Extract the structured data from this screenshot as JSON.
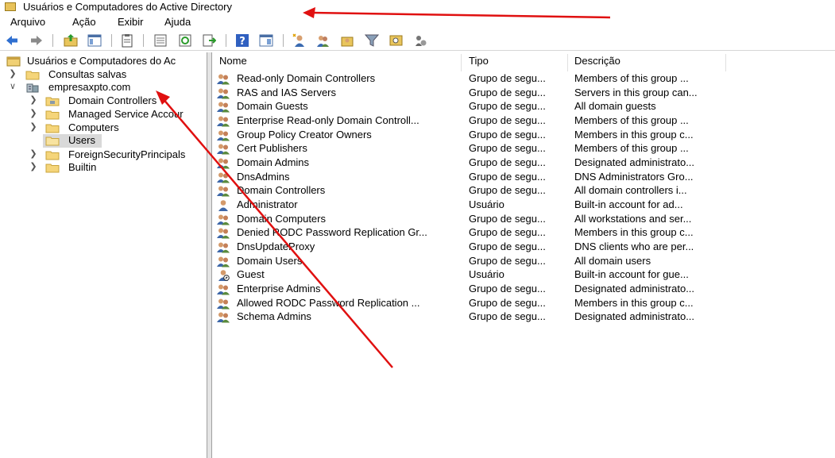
{
  "window": {
    "title": "Usuários e Computadores do Active Directory"
  },
  "menu": [
    "Arquivo",
    "Ação",
    "Exibir",
    "Ajuda"
  ],
  "tree": {
    "root": "Usuários e Computadores do Ac",
    "saved_queries": "Consultas salvas",
    "domain": "empresaxpto.com",
    "children": [
      "Domain Controllers",
      "Managed Service Accour",
      "Computers",
      "Users",
      "ForeignSecurityPrincipals",
      "Builtin"
    ],
    "selected": "Users"
  },
  "columns": {
    "name": "Nome",
    "type": "Tipo",
    "description": "Descrição"
  },
  "rows": [
    {
      "icon": "group",
      "name": "Read-only Domain Controllers",
      "type": "Grupo de segu...",
      "description": "Members of this group ..."
    },
    {
      "icon": "group",
      "name": "RAS and IAS Servers",
      "type": "Grupo de segu...",
      "description": "Servers in this group can..."
    },
    {
      "icon": "group",
      "name": "Domain Guests",
      "type": "Grupo de segu...",
      "description": "All domain guests"
    },
    {
      "icon": "group",
      "name": "Enterprise Read-only Domain Controll...",
      "type": "Grupo de segu...",
      "description": "Members of this group ..."
    },
    {
      "icon": "group",
      "name": "Group Policy Creator Owners",
      "type": "Grupo de segu...",
      "description": "Members in this group c..."
    },
    {
      "icon": "group",
      "name": "Cert Publishers",
      "type": "Grupo de segu...",
      "description": "Members of this group ..."
    },
    {
      "icon": "group",
      "name": "Domain Admins",
      "type": "Grupo de segu...",
      "description": "Designated administrato..."
    },
    {
      "icon": "group",
      "name": "DnsAdmins",
      "type": "Grupo de segu...",
      "description": "DNS Administrators Gro..."
    },
    {
      "icon": "group",
      "name": "Domain Controllers",
      "type": "Grupo de segu...",
      "description": "All domain controllers i..."
    },
    {
      "icon": "user",
      "name": "Administrator",
      "type": "Usuário",
      "description": "Built-in account for ad..."
    },
    {
      "icon": "group",
      "name": "Domain Computers",
      "type": "Grupo de segu...",
      "description": "All workstations and ser..."
    },
    {
      "icon": "group",
      "name": "Denied RODC Password Replication Gr...",
      "type": "Grupo de segu...",
      "description": "Members in this group c..."
    },
    {
      "icon": "group",
      "name": "DnsUpdateProxy",
      "type": "Grupo de segu...",
      "description": "DNS clients who are per..."
    },
    {
      "icon": "group",
      "name": "Domain Users",
      "type": "Grupo de segu...",
      "description": "All domain users"
    },
    {
      "icon": "user-disabled",
      "name": "Guest",
      "type": "Usuário",
      "description": "Built-in account for gue..."
    },
    {
      "icon": "group",
      "name": "Enterprise Admins",
      "type": "Grupo de segu...",
      "description": "Designated administrato..."
    },
    {
      "icon": "group",
      "name": "Allowed RODC Password Replication ...",
      "type": "Grupo de segu...",
      "description": "Members in this group c..."
    },
    {
      "icon": "group",
      "name": "Schema Admins",
      "type": "Grupo de segu...",
      "description": "Designated administrato..."
    }
  ],
  "toolbar_icons": [
    "back-icon",
    "forward-icon",
    "up-folder-icon",
    "console-tree-icon",
    "clipboard-icon",
    "properties-icon",
    "refresh-icon",
    "export-list-icon",
    "help-icon",
    "view-icon",
    "new-user-icon",
    "new-group-icon",
    "add-to-group-icon",
    "filter-icon",
    "find-icon",
    "manage-icon"
  ],
  "colors": {
    "annotation_arrow": "#e01010",
    "folder": "#f5d57a",
    "selection": "#d9d9d9"
  }
}
